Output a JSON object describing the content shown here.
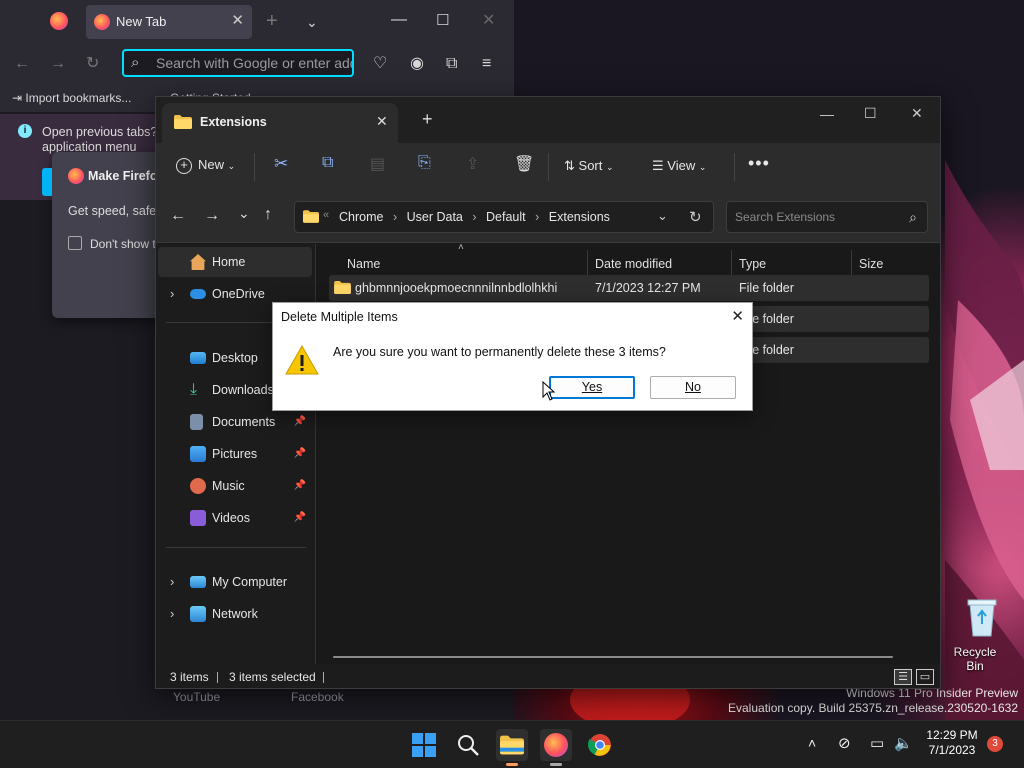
{
  "desktop": {
    "recycle_bin_label": "Recycle Bin",
    "watermark_line1": "Windows 11 Pro Insider Preview",
    "watermark_line2": "Evaluation copy. Build 25375.zn_release.230520-1632"
  },
  "firefox": {
    "tab_title": "New Tab",
    "url_placeholder": "Search with Google or enter add",
    "bookmark_import": "Import bookmarks...",
    "bookmark_getting_started": "Getting Started",
    "notice_text": "Open previous tabs? V",
    "notice_text2": "application menu",
    "popup_title": "Make Firefox",
    "popup_body": "Get speed, safety",
    "popup_checkbox": "Don't show t",
    "shortcut1": "YouTube",
    "shortcut2": "Facebook"
  },
  "explorer": {
    "tab_title": "Extensions",
    "toolbar": {
      "new_label": "New",
      "sort_label": "Sort",
      "view_label": "View"
    },
    "breadcrumb": [
      "Chrome",
      "User Data",
      "Default",
      "Extensions"
    ],
    "search_placeholder": "Search Extensions",
    "nav": {
      "home": "Home",
      "onedrive": "OneDrive",
      "desktop": "Desktop",
      "downloads": "Downloads",
      "documents": "Documents",
      "pictures": "Pictures",
      "music": "Music",
      "videos": "Videos",
      "my_computer": "My Computer",
      "network": "Network"
    },
    "columns": {
      "name": "Name",
      "date": "Date modified",
      "type": "Type",
      "size": "Size"
    },
    "rows": [
      {
        "name": "ghbmnnjooekpmoecnnnilnnbdlolhkhi",
        "date": "7/1/2023 12:27 PM",
        "type": "File folder"
      },
      {
        "name": "",
        "date": "",
        "type": "File folder"
      },
      {
        "name": "",
        "date": "",
        "type": "File folder"
      }
    ],
    "status": {
      "count": "3 items",
      "selected": "3 items selected"
    }
  },
  "dialog": {
    "title": "Delete Multiple Items",
    "message": "Are you sure you want to permanently delete these 3 items?",
    "yes_label": "Yes",
    "no_label": "No"
  },
  "taskbar": {
    "time": "12:29 PM",
    "date": "7/1/2023",
    "notification_count": "3"
  },
  "colors": {
    "accent": "#0078d4",
    "firefox_focus": "#00ddff",
    "warning": "#f7c600"
  }
}
